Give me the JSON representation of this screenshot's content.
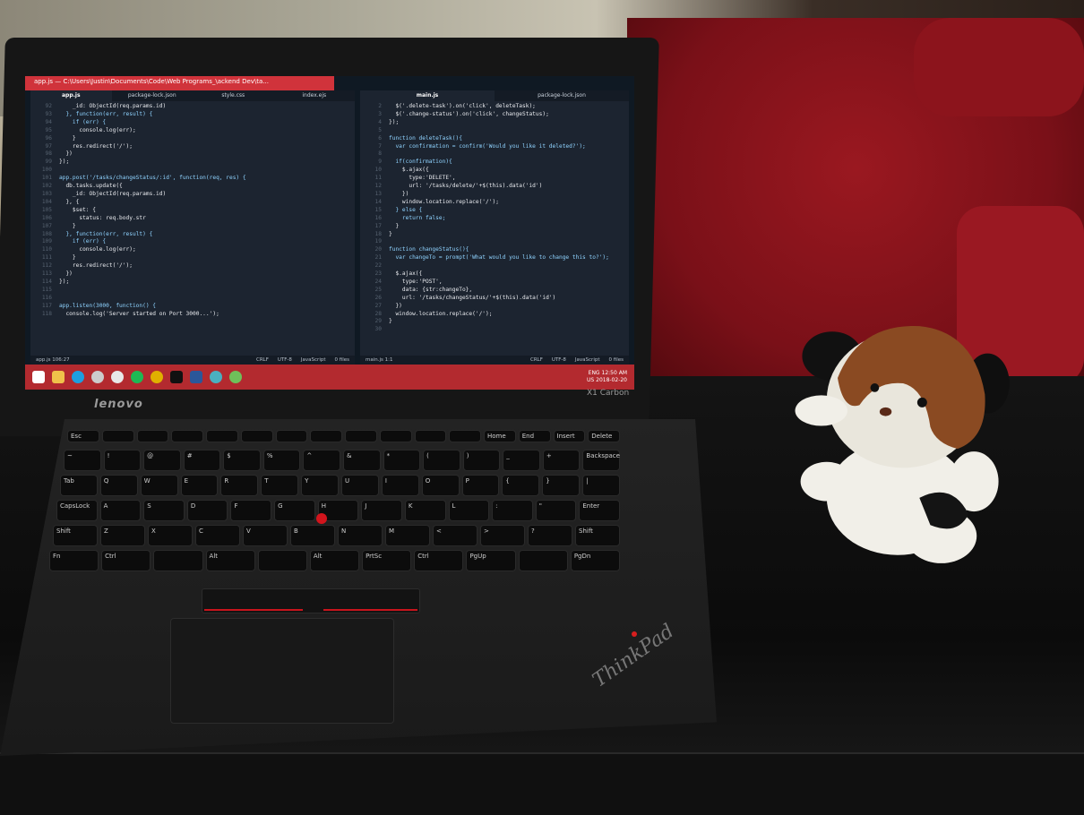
{
  "editor_left": {
    "window_title": "app.js — C:\\Users\\Justin\\Documents\\Code\\Web Programs_\\ackend Dev\\ta...",
    "tabs": [
      "app.js",
      "package-lock.json",
      "style.css",
      "index.ejs"
    ],
    "active_tab": "app.js",
    "line_numbers": [
      "92",
      "93",
      "94",
      "95",
      "96",
      "97",
      "98",
      "99",
      "100",
      "101",
      "102",
      "103",
      "104",
      "105",
      "106",
      "107",
      "108",
      "109",
      "110",
      "111",
      "112",
      "113",
      "114",
      "115",
      "116",
      "117",
      "118"
    ],
    "code_lines": [
      "    _id: ObjectId(req.params.id)",
      "  }, function(err, result) {",
      "    if (err) {",
      "      console.log(err);",
      "    }",
      "    res.redirect('/');",
      "  })",
      "});",
      "",
      "app.post('/tasks/changeStatus/:id', function(req, res) {",
      "  db.tasks.update({",
      "    _id: ObjectId(req.params.id)",
      "  }, {",
      "    $set: {",
      "      status: req.body.str",
      "    }",
      "  }, function(err, result) {",
      "    if (err) {",
      "      console.log(err);",
      "    }",
      "    res.redirect('/');",
      "  })",
      "});",
      "",
      "",
      "app.listen(3000, function() {",
      "  console.log('Server started on Port 3000...');"
    ],
    "status_left": "app.js   106:27",
    "status_right": [
      "CRLF",
      "UTF-8",
      "JavaScript",
      "0 files"
    ]
  },
  "editor_right": {
    "tabs": [
      "main.js",
      "package-lock.json"
    ],
    "active_tab": "main.js",
    "line_numbers": [
      "2",
      "3",
      "4",
      "5",
      "6",
      "7",
      "8",
      "9",
      "10",
      "11",
      "12",
      "13",
      "14",
      "15",
      "16",
      "17",
      "18",
      "19",
      "20",
      "21",
      "22",
      "23",
      "24",
      "25",
      "26",
      "27",
      "28",
      "29",
      "30"
    ],
    "code_lines": [
      "  $('.delete-task').on('click', deleteTask);",
      "  $('.change-status').on('click', changeStatus);",
      "});",
      "",
      "function deleteTask(){",
      "  var confirmation = confirm('Would you like it deleted?');",
      "",
      "  if(confirmation){",
      "    $.ajax({",
      "      type:'DELETE',",
      "      url: '/tasks/delete/'+$(this).data('id')",
      "    })",
      "    window.location.replace('/');",
      "  } else {",
      "    return false;",
      "  }",
      "}",
      "",
      "function changeStatus(){",
      "  var changeTo = prompt('What would you like to change this to?');",
      "",
      "  $.ajax({",
      "    type:'POST',",
      "    data: {str:changeTo},",
      "    url: '/tasks/changeStatus/'+$(this).data('id')",
      "  })",
      "  window.location.replace('/');",
      "}",
      ""
    ],
    "status_left": "main.js   1:1",
    "status_right": [
      "CRLF",
      "UTF-8",
      "JavaScript",
      "0 files"
    ]
  },
  "taskbar": {
    "language": "ENG",
    "region": "US",
    "time": "12:50 AM",
    "date": "2018-02-20"
  },
  "laptop": {
    "bezel_logo": "lenovo",
    "model": "X1 Carbon",
    "brand": "ThinkPad"
  },
  "keyboard": {
    "rows": [
      [
        "Esc",
        "",
        "",
        "",
        "",
        "",
        "",
        "",
        "",
        "",
        "",
        "",
        "Home",
        "End",
        "Insert",
        "Delete"
      ],
      [
        "~",
        "!",
        "@",
        "#",
        "$",
        "%",
        "^",
        "&",
        "*",
        "(",
        ")",
        "_",
        "+",
        "Backspace"
      ],
      [
        "Tab",
        "Q",
        "W",
        "E",
        "R",
        "T",
        "Y",
        "U",
        "I",
        "O",
        "P",
        "{",
        "}",
        "|"
      ],
      [
        "CapsLock",
        "A",
        "S",
        "D",
        "F",
        "G",
        "H",
        "J",
        "K",
        "L",
        ":",
        "\"",
        "Enter"
      ],
      [
        "Shift",
        "Z",
        "X",
        "C",
        "V",
        "B",
        "N",
        "M",
        "<",
        ">",
        "?",
        "Shift"
      ],
      [
        "Fn",
        "Ctrl",
        "",
        "Alt",
        "",
        "Alt",
        "PrtSc",
        "Ctrl",
        "PgUp",
        "",
        "PgDn"
      ]
    ]
  },
  "colors": {
    "title_bar": "#d0333b",
    "taskbar": "#b32a2f",
    "editor_bg": "#1c2430",
    "couch": "#8c141c",
    "trackpoint": "#d2141c"
  }
}
